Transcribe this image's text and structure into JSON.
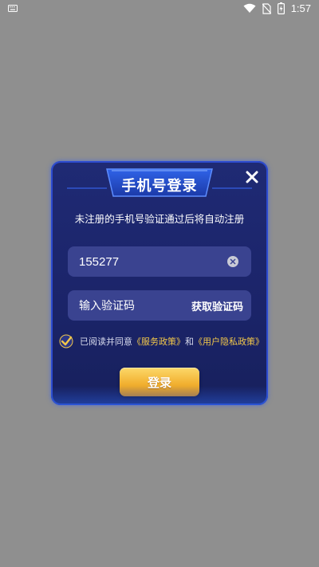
{
  "status_bar": {
    "time": "1:57",
    "icons": [
      "keyboard-icon",
      "wifi-icon",
      "no-sim-icon",
      "battery-charging-icon"
    ]
  },
  "dialog": {
    "title": "手机号登录",
    "close_icon": "close-icon",
    "hint": "未注册的手机号验证通过后将自动注册",
    "phone": {
      "value": "155277",
      "clear_icon": "clear-icon"
    },
    "code": {
      "placeholder": "输入验证码",
      "get_code_label": "获取验证码"
    },
    "agreement": {
      "checked": true,
      "prefix": "已阅读并同意",
      "service_policy": "《服务政策》",
      "and": "和",
      "privacy_policy": "《用户隐私政策》"
    },
    "login_label": "登录"
  },
  "colors": {
    "background": "#8f8f8f",
    "dialog": "#1f2a74",
    "field": "#3a4390",
    "accent_gold": "#f3c84a",
    "border_blue": "#2c4bd0"
  }
}
